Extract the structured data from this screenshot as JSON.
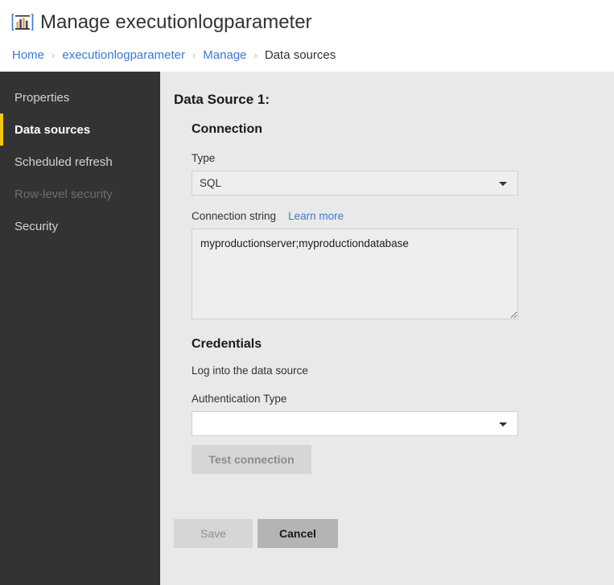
{
  "header": {
    "icon": "report-bar-chart-icon",
    "title": "Manage executionlogparameter",
    "breadcrumb": [
      {
        "label": "Home",
        "current": false
      },
      {
        "label": "executionlogparameter",
        "current": false
      },
      {
        "label": "Manage",
        "current": false
      },
      {
        "label": "Data sources",
        "current": true
      }
    ],
    "separator": "›"
  },
  "sidebar": {
    "items": [
      {
        "label": "Properties",
        "state": "normal"
      },
      {
        "label": "Data sources",
        "state": "selected"
      },
      {
        "label": "Scheduled refresh",
        "state": "normal"
      },
      {
        "label": "Row-level security",
        "state": "disabled"
      },
      {
        "label": "Security",
        "state": "normal"
      }
    ],
    "accent_color": "#f2c80f",
    "background_color": "#333333"
  },
  "main": {
    "data_source_title": "Data Source 1:",
    "connection": {
      "heading": "Connection",
      "type_label": "Type",
      "type_value": "SQL",
      "type_options": [
        "SQL"
      ],
      "connection_string_label": "Connection string",
      "learn_more_label": "Learn more",
      "connection_string_value": "myproductionserver;myproductiondatabase",
      "connection_string_placeholder": ""
    },
    "credentials": {
      "heading": "Credentials",
      "description": "Log into the data source",
      "auth_type_label": "Authentication Type",
      "auth_type_value": "",
      "auth_type_options": [
        ""
      ],
      "test_connection_label": "Test connection"
    },
    "footer": {
      "save_label": "Save",
      "cancel_label": "Cancel"
    }
  }
}
